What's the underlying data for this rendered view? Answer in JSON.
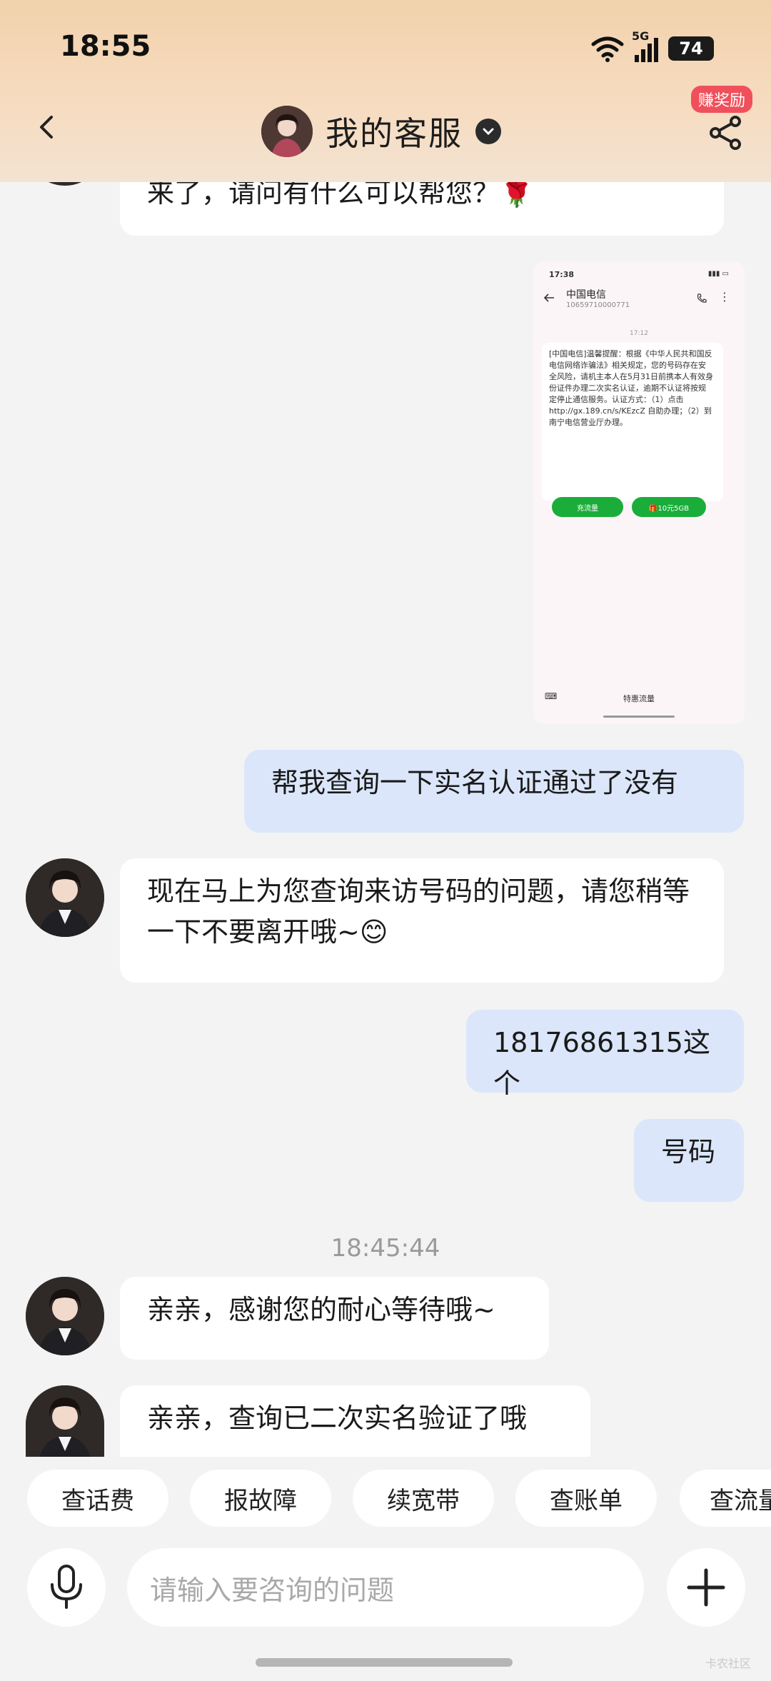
{
  "status_bar": {
    "time": "18:55",
    "network": "5G",
    "battery": "74"
  },
  "header": {
    "title": "我的客服",
    "reward_badge": "赚奖励"
  },
  "messages": [
    {
      "text": "来了，请问有什么可以帮您？🌹"
    },
    {
      "text": "帮我查询一下实名认证通过了没有"
    },
    {
      "text": "现在马上为您查询来访号码的问题，请您稍等一下不要离开哦~😊"
    },
    {
      "text": "18176861315这个"
    },
    {
      "text": "号码"
    },
    {
      "text": "亲亲，感谢您的耐心等待哦~"
    },
    {
      "text": "亲亲，查询已二次实名验证了哦"
    }
  ],
  "timestamp": "18:45:44",
  "screenshot": {
    "time": "17:38",
    "sender": "中国电信",
    "number": "10659710000771",
    "sms_time": "17:12",
    "body": "[中国电信]温馨提醒：根据《中华人民共和国反电信网络诈骗法》相关规定，您的号码存在安全风险，请机主本人在5月31日前携本人有效身份证件办理二次实名认证，逾期不认证将按规定停止通信服务。认证方式：（1）点击 http://gx.189.cn/s/KEzcZ 自助办理；（2）到南宁电信营业厅办理。",
    "btn1": "充流量",
    "btn2": "🎁10元5GB",
    "bottom": "特惠流量"
  },
  "quick_replies": [
    "查话费",
    "报故障",
    "续宽带",
    "查账单",
    "查流量"
  ],
  "input": {
    "placeholder": "请输入要咨询的问题"
  },
  "watermark": "卡农社区"
}
